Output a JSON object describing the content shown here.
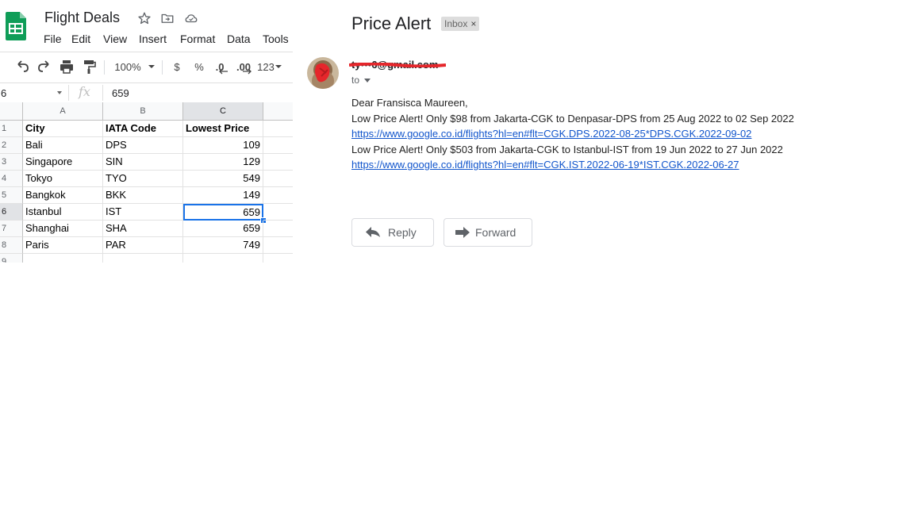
{
  "sheets": {
    "doc_title": "Flight Deals",
    "menu": [
      "File",
      "Edit",
      "View",
      "Insert",
      "Format",
      "Data",
      "Tools"
    ],
    "toolbar": {
      "zoom": "100%",
      "currency": "$",
      "percent": "%",
      "decrease_decimal": ".0",
      "increase_decimal": ".00",
      "more_formats": "123"
    },
    "namebox": "6",
    "formula_value": "659",
    "columns": [
      "A",
      "B",
      "C"
    ],
    "rows": [
      {
        "num": "1",
        "a": "City",
        "b": "IATA Code",
        "c": "Lowest Price"
      },
      {
        "num": "2",
        "a": "Bali",
        "b": "DPS",
        "c": "109"
      },
      {
        "num": "3",
        "a": "Singapore",
        "b": "SIN",
        "c": "129"
      },
      {
        "num": "4",
        "a": "Tokyo",
        "b": "TYO",
        "c": "549"
      },
      {
        "num": "5",
        "a": "Bangkok",
        "b": "BKK",
        "c": "149"
      },
      {
        "num": "6",
        "a": "Istanbul",
        "b": "IST",
        "c": "659"
      },
      {
        "num": "7",
        "a": "Shanghai",
        "b": "SHA",
        "c": "659"
      },
      {
        "num": "8",
        "a": "Paris",
        "b": "PAR",
        "c": "749"
      },
      {
        "num": "9",
        "a": "",
        "b": "",
        "c": ""
      }
    ]
  },
  "email": {
    "subject": "Price Alert",
    "label": "Inbox",
    "label_close": "×",
    "sender": "ty•••6@gmail.com",
    "to": "to",
    "greeting": " Dear Fransisca Maureen,",
    "alert1": " Low Price Alert! Only $98 from Jakarta-CGK to Denpasar-DPS from 25 Aug 2022 to 02 Sep 2022",
    "link1": "https://www.google.co.id/flights?hl=en#flt=CGK.DPS.2022-08-25*DPS.CGK.2022-09-02",
    "alert2": "Low Price Alert! Only $503 from Jakarta-CGK to Istanbul-IST from 19 Jun 2022 to 27 Jun 2022",
    "link2": "https://www.google.co.id/flights?hl=en#flt=CGK.IST.2022-06-19*IST.CGK.2022-06-27",
    "reply": "Reply",
    "forward": "Forward"
  },
  "colors": {
    "sheets_green": "#0f9d58",
    "selection_blue": "#1a73e8",
    "link_blue": "#1155cc",
    "redaction_red": "#e5262b"
  }
}
